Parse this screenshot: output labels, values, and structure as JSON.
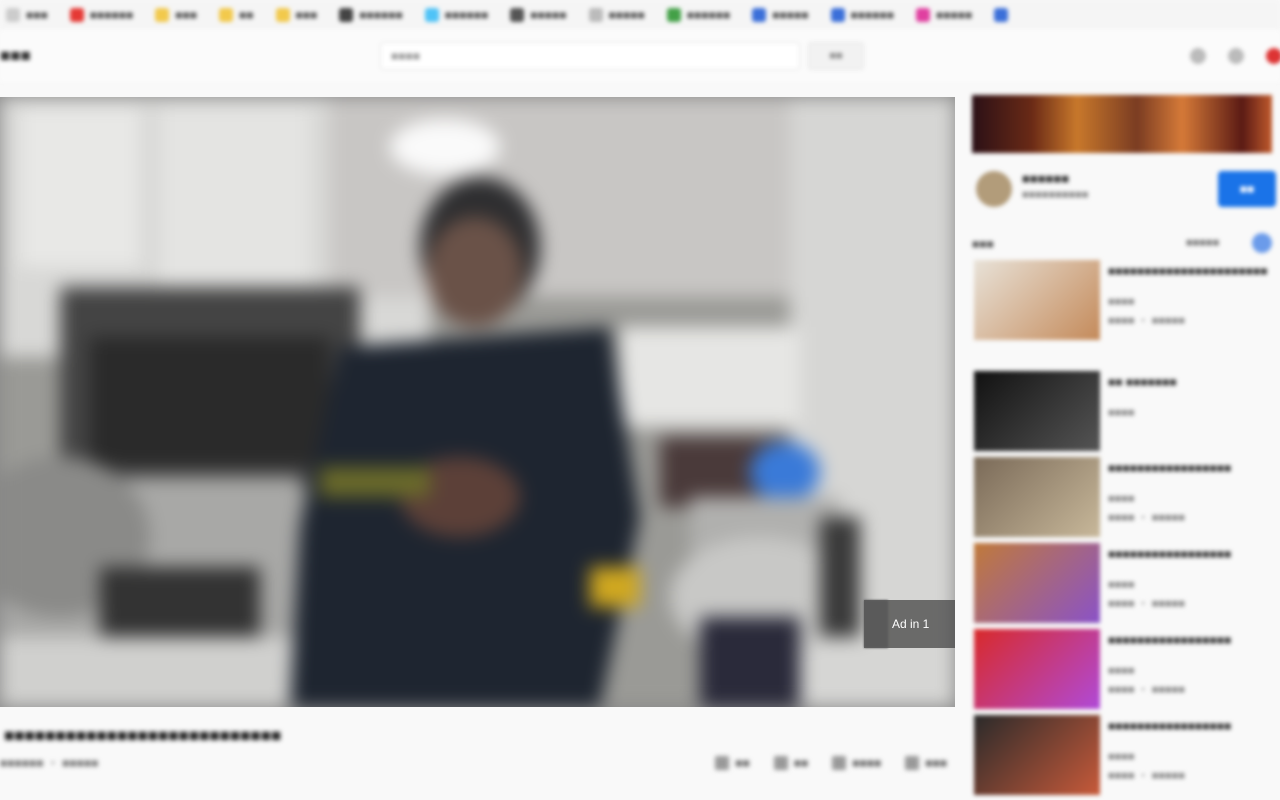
{
  "bookmarks": [
    {
      "label": "■■■",
      "fav_color": "#cccccc"
    },
    {
      "label": "■■■■■■",
      "fav_color": "#e53935"
    },
    {
      "label": "■■■",
      "fav_color": "#f2c94c"
    },
    {
      "label": "■■",
      "fav_color": "#f2c94c"
    },
    {
      "label": "■■■",
      "fav_color": "#f2c94c"
    },
    {
      "label": "■■■■■■",
      "fav_color": "#444444"
    },
    {
      "label": "■■■■■■",
      "fav_color": "#4fc3f7"
    },
    {
      "label": "■■■■■",
      "fav_color": "#555555"
    },
    {
      "label": "■■■■■",
      "fav_color": "#bbbbbb"
    },
    {
      "label": "■■■■■■",
      "fav_color": "#43a047"
    },
    {
      "label": "■■■■■",
      "fav_color": "#3b6fd9"
    },
    {
      "label": "■■■■■■",
      "fav_color": "#3b6fd9"
    },
    {
      "label": "■■■■■",
      "fav_color": "#e040a0"
    },
    {
      "label": "",
      "fav_color": "#3b6fd9"
    }
  ],
  "header": {
    "brand": "■■■",
    "search_placeholder": "■■■■",
    "search_button": "■■"
  },
  "player": {
    "ad_text": "Ad in 1"
  },
  "video": {
    "title": "■■■■■■■■■■■■■■■■■■■■■■■■■■■",
    "meta": "■■■■■■ ・ ■■■■■",
    "actions": [
      "■■",
      "■■",
      "■■■■",
      "■■■"
    ]
  },
  "channel": {
    "name": "■■■■■■",
    "subs": "■■■■■■■■■■",
    "subscribe": "■■"
  },
  "sidebar": {
    "up_next": "■■■",
    "autoplay": "■■■■■",
    "recommendations": [
      {
        "title": "■■■■■■■■■■■■■■■■■■■■■■",
        "channel": "■■■■",
        "views": "■■■■ ・ ■■■■■",
        "thumb": [
          "#e8e2d8",
          "#c48a5a"
        ]
      },
      {
        "title": "■■ ■■■■■■■",
        "channel": "■■■■",
        "views": "",
        "thumb": [
          "#111111",
          "#555555"
        ]
      },
      {
        "title": "■■■■■■■■■■■■■■■■■",
        "channel": "■■■■",
        "views": "■■■■ ・ ■■■■■",
        "thumb": [
          "#7a6a58",
          "#c8b89a"
        ]
      },
      {
        "title": "■■■■■■■■■■■■■■■■■",
        "channel": "■■■■",
        "views": "■■■■ ・ ■■■■■",
        "thumb": [
          "#c07a3a",
          "#8a52c8"
        ]
      },
      {
        "title": "■■■■■■■■■■■■■■■■■",
        "channel": "■■■■",
        "views": "■■■■ ・ ■■■■■",
        "thumb": [
          "#d82a2a",
          "#b04ad8"
        ]
      },
      {
        "title": "■■■■■■■■■■■■■■■■■",
        "channel": "■■■■",
        "views": "■■■■ ・ ■■■■■",
        "thumb": [
          "#2a2a2a",
          "#c85a3a"
        ]
      }
    ]
  }
}
